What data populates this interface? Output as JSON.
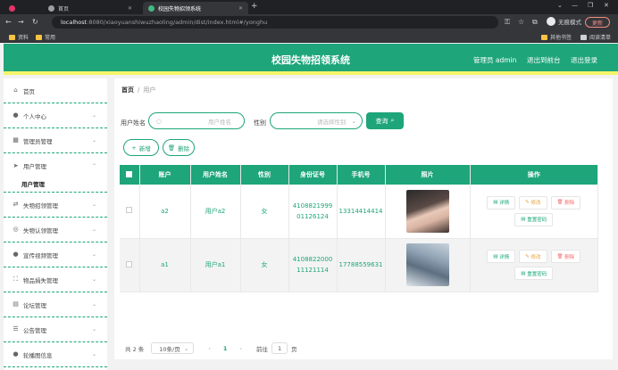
{
  "browser": {
    "tabs": [
      {
        "label": "首页"
      },
      {
        "label": "校园失物招领系统"
      }
    ],
    "overlay_text": "localhost",
    "url_host": "localhost",
    "url_path": ":8080/xiaoyuanshiwuzhaoling/admin/dist/index.html#/yonghu",
    "incognito_label": "无痕模式",
    "update_label": "更新",
    "bookmarks": [
      "资料",
      "常用"
    ],
    "bookmarks_right": [
      "其他书签",
      "阅读清单"
    ]
  },
  "header": {
    "title": "校园失物招领系统",
    "admin_label": "管理员 admin",
    "back_label": "退出到前台",
    "logout_label": "退出登录"
  },
  "sidebar": {
    "items": [
      {
        "label": "首页",
        "icon": "home-icon"
      },
      {
        "label": "个人中心",
        "icon": "user-icon"
      },
      {
        "label": "管理员管理",
        "icon": "grid-icon"
      },
      {
        "label": "用户管理",
        "icon": "send-icon"
      },
      {
        "label": "失物招领管理",
        "icon": "swap-icon"
      },
      {
        "label": "失物认领管理",
        "icon": "globe-icon"
      },
      {
        "label": "宣传视频管理",
        "icon": "user-icon"
      },
      {
        "label": "物品捐失管理",
        "icon": "frame-icon"
      },
      {
        "label": "论坛管理",
        "icon": "doc-icon"
      },
      {
        "label": "公告管理",
        "icon": "list-icon"
      },
      {
        "label": "轮播图信息",
        "icon": "user-icon"
      }
    ],
    "sub_item": "用户管理"
  },
  "breadcrumb": {
    "home": "首页",
    "current": "用户"
  },
  "search": {
    "name_label": "用户姓名",
    "name_placeholder": "用户姓名",
    "gender_label": "性别",
    "gender_placeholder": "请选择性别",
    "query_label": "查询"
  },
  "actions": {
    "add_label": "新增",
    "delete_label": "删除"
  },
  "table": {
    "headers": [
      "账户",
      "用户姓名",
      "性别",
      "身份证号",
      "手机号",
      "照片",
      "操作"
    ],
    "rows": [
      {
        "account": "a2",
        "name": "用户a2",
        "gender": "女",
        "idcard": "410882199901126124",
        "phone": "13314414414"
      },
      {
        "account": "a1",
        "name": "用户a1",
        "gender": "女",
        "idcard": "410882200011121114",
        "phone": "17788559631"
      }
    ],
    "ops": {
      "detail": "详情",
      "edit": "修改",
      "delete": "删除",
      "reset": "重置密码"
    }
  },
  "pager": {
    "total": "共 2 条",
    "page_size": "10条/页",
    "current_page": "1",
    "goto_label": "前往",
    "goto_value": "1",
    "page_suffix": "页"
  },
  "colors": {
    "brand": "#1ea57a",
    "accent_bar": "#f5f56a"
  }
}
